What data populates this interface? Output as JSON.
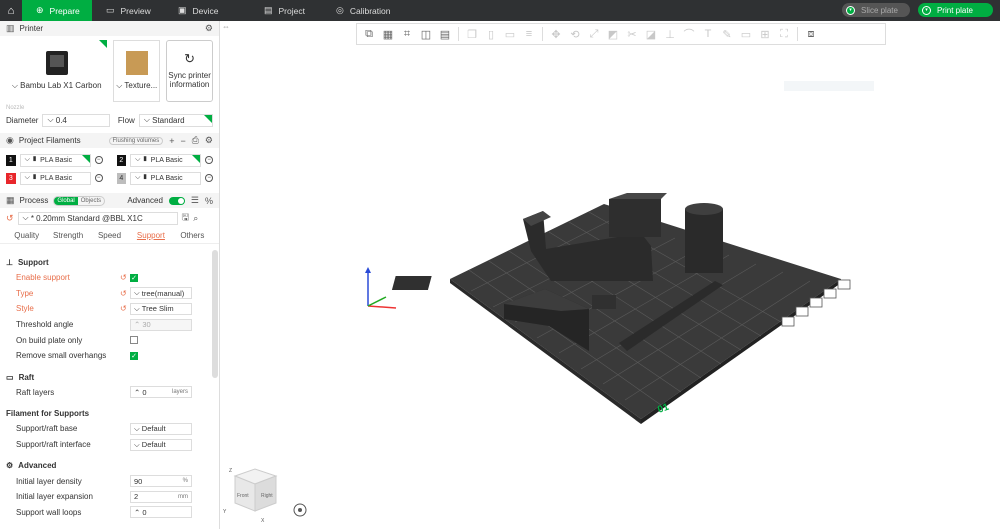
{
  "topbar": {
    "tabs": [
      {
        "label": "Prepare",
        "icon": "cube-icon"
      },
      {
        "label": "Preview",
        "icon": "monitor-icon"
      },
      {
        "label": "Device",
        "icon": "device-icon"
      },
      {
        "label": "Project",
        "icon": "folder-icon"
      },
      {
        "label": "Calibration",
        "icon": "target-icon"
      }
    ],
    "slice_label": "Slice plate",
    "print_label": "Print plate"
  },
  "printer_section": {
    "title": "Printer",
    "printer_name": "Bambu Lab X1 Carbon",
    "plate_name": "Texture...",
    "sync_label_1": "Sync printer",
    "sync_label_2": "information",
    "nozzle_label": "Nozzle",
    "diameter_label": "Diameter",
    "diameter_value": "0.4",
    "flow_label": "Flow",
    "flow_value": "Standard"
  },
  "filaments": {
    "title": "Project Filaments",
    "flushing_label": "Flushing volumes",
    "items": [
      {
        "num": "1",
        "name": "PLA Basic",
        "color": "#111111"
      },
      {
        "num": "2",
        "name": "PLA Basic",
        "color": "#111111"
      },
      {
        "num": "3",
        "name": "PLA Basic",
        "color": "#e8262b"
      },
      {
        "num": "4",
        "name": "PLA Basic",
        "color": "#bdbdbd"
      }
    ]
  },
  "process": {
    "title": "Process",
    "global_label": "Global",
    "objects_label": "Objects",
    "advanced_label": "Advanced",
    "preset": "* 0.20mm Standard @BBL X1C",
    "tabs": [
      "Quality",
      "Strength",
      "Speed",
      "Support",
      "Others"
    ],
    "active_tab": "Support"
  },
  "support": {
    "group_support": "Support",
    "enable_support": "Enable support",
    "type_label": "Type",
    "type_value": "tree(manual)",
    "style_label": "Style",
    "style_value": "Tree Slim",
    "threshold_label": "Threshold angle",
    "threshold_value": "30",
    "build_plate_only": "On build plate only",
    "remove_small": "Remove small overhangs",
    "group_raft": "Raft",
    "raft_layers_label": "Raft layers",
    "raft_layers_value": "0",
    "raft_layers_unit": "layers",
    "group_filament": "Filament for Supports",
    "base_label": "Support/raft base",
    "base_value": "Default",
    "interface_label": "Support/raft interface",
    "interface_value": "Default",
    "group_advanced": "Advanced",
    "density_label": "Initial layer density",
    "density_value": "90",
    "density_unit": "%",
    "expansion_label": "Initial layer expansion",
    "expansion_value": "2",
    "expansion_unit": "mm",
    "wall_loops_label": "Support wall loops",
    "wall_loops_value": "0"
  },
  "viewport": {
    "plate_number": "01",
    "cube_front": "Front",
    "cube_right": "Right",
    "axis_z": "Z",
    "axis_x": "X",
    "axis_y": "Y"
  }
}
